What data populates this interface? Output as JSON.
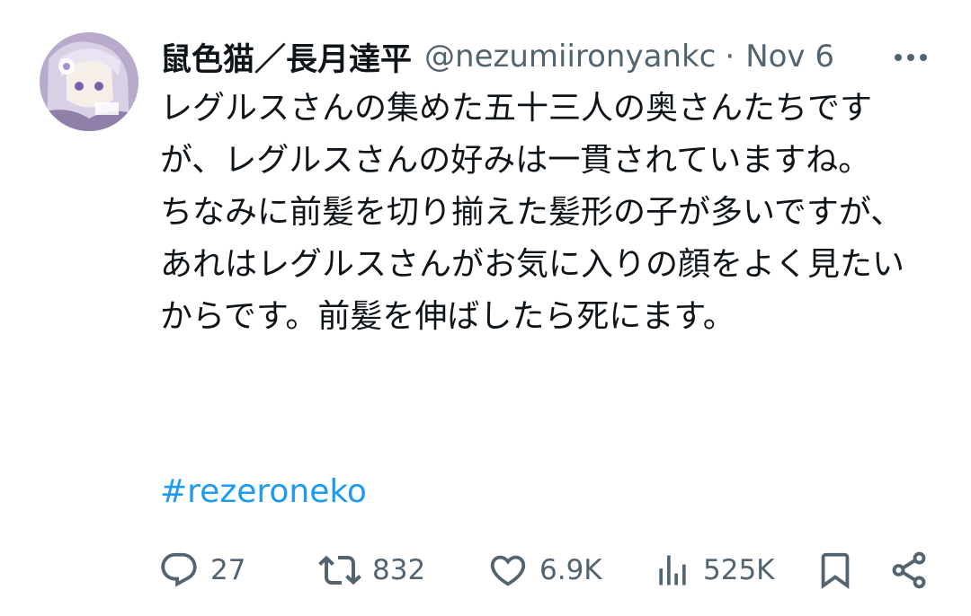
{
  "post": {
    "display_name": "鼠色猫／長月達平",
    "handle": "@nezumiironyankc",
    "separator": "·",
    "date": "Nov 6",
    "body": "レグルスさんの集めた五十三人の奥さんたちですが、レグルスさんの好みは一貫されていますね。\nちなみに前髪を切り揃えた髪形の子が多いですが、あれはレグルスさんがお気に入りの顔をよく見たいからです。前髪を伸ばしたら死にます。",
    "hashtag": "#rezeroneko"
  },
  "actions": {
    "replies": "27",
    "reposts": "832",
    "likes": "6.9K",
    "views": "525K"
  },
  "colors": {
    "text": "#0f1419",
    "secondary": "#536471",
    "link": "#1d9bf0"
  },
  "icons": [
    "avatar",
    "more-icon",
    "reply-icon",
    "repost-icon",
    "like-icon",
    "views-icon",
    "bookmark-icon",
    "share-icon"
  ]
}
